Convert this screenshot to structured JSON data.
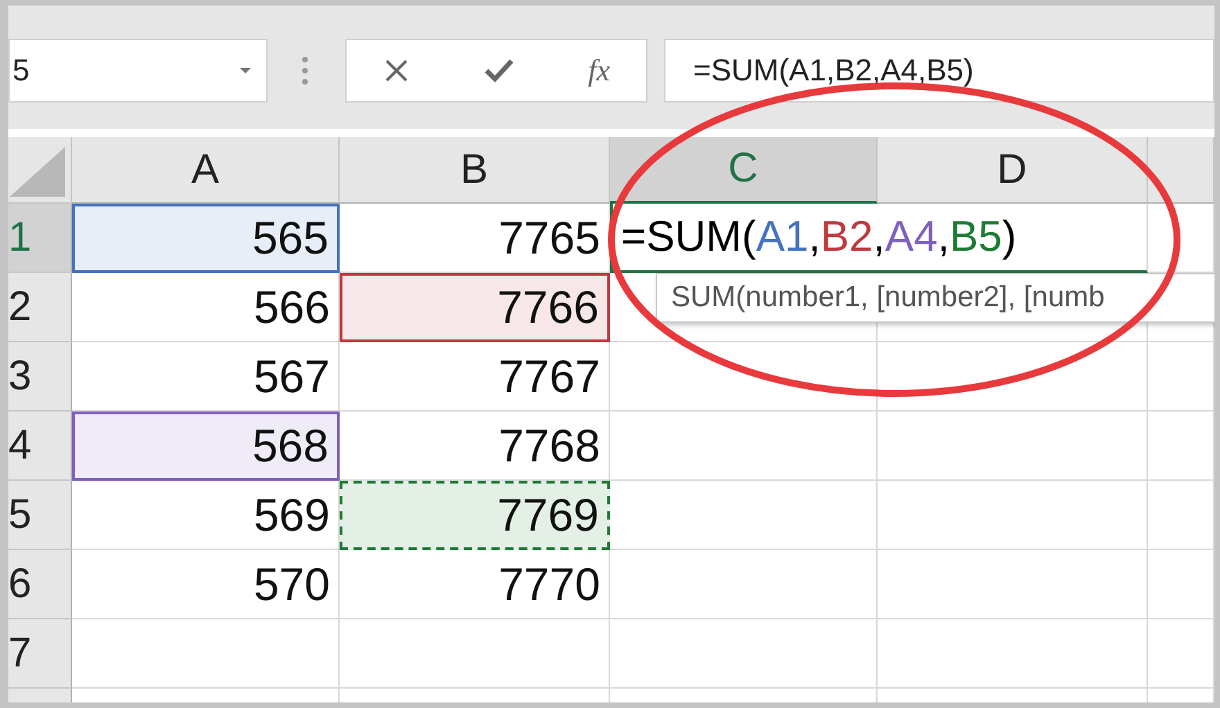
{
  "name_box": {
    "value": "5"
  },
  "formula_bar": {
    "function_button": "fx",
    "value": "=SUM(A1,B2,A4,B5)"
  },
  "columns": [
    {
      "label": "A",
      "selected": false
    },
    {
      "label": "B",
      "selected": false
    },
    {
      "label": "C",
      "selected": true
    },
    {
      "label": "D",
      "selected": false
    }
  ],
  "rows": [
    {
      "label": "1",
      "selected": true,
      "cells": [
        {
          "value": "565",
          "highlight": {
            "color": "#4472c4",
            "dashed": false
          }
        },
        {
          "value": "7765"
        },
        {
          "kind": "editing",
          "parts": [
            {
              "text": "=SUM(",
              "color": "#000000"
            },
            {
              "text": "A1",
              "color": "#4472c4"
            },
            {
              "text": ",",
              "color": "#000000"
            },
            {
              "text": "B2",
              "color": "#c0393f"
            },
            {
              "text": ",",
              "color": "#000000"
            },
            {
              "text": "A4",
              "color": "#7f5fbf"
            },
            {
              "text": ",",
              "color": "#000000"
            },
            {
              "text": "B5",
              "color": "#1e7b34"
            },
            {
              "text": ")",
              "color": "#000000"
            }
          ]
        }
      ]
    },
    {
      "label": "2",
      "selected": false,
      "cells": [
        {
          "value": "566"
        },
        {
          "value": "7766",
          "highlight": {
            "color": "#c0393f",
            "dashed": false
          }
        }
      ]
    },
    {
      "label": "3",
      "selected": false,
      "cells": [
        {
          "value": "567"
        },
        {
          "value": "7767"
        }
      ]
    },
    {
      "label": "4",
      "selected": false,
      "cells": [
        {
          "value": "568",
          "highlight": {
            "color": "#7f5fbf",
            "dashed": false
          }
        },
        {
          "value": "7768"
        }
      ]
    },
    {
      "label": "5",
      "selected": false,
      "cells": [
        {
          "value": "569"
        },
        {
          "value": "7769",
          "highlight": {
            "color": "#1e7b34",
            "dashed": true
          }
        }
      ]
    },
    {
      "label": "6",
      "selected": false,
      "cells": [
        {
          "value": "570"
        },
        {
          "value": "7770"
        }
      ]
    },
    {
      "label": "7",
      "selected": false,
      "cells": []
    }
  ],
  "tooltip": "SUM(number1, [number2], [numb"
}
